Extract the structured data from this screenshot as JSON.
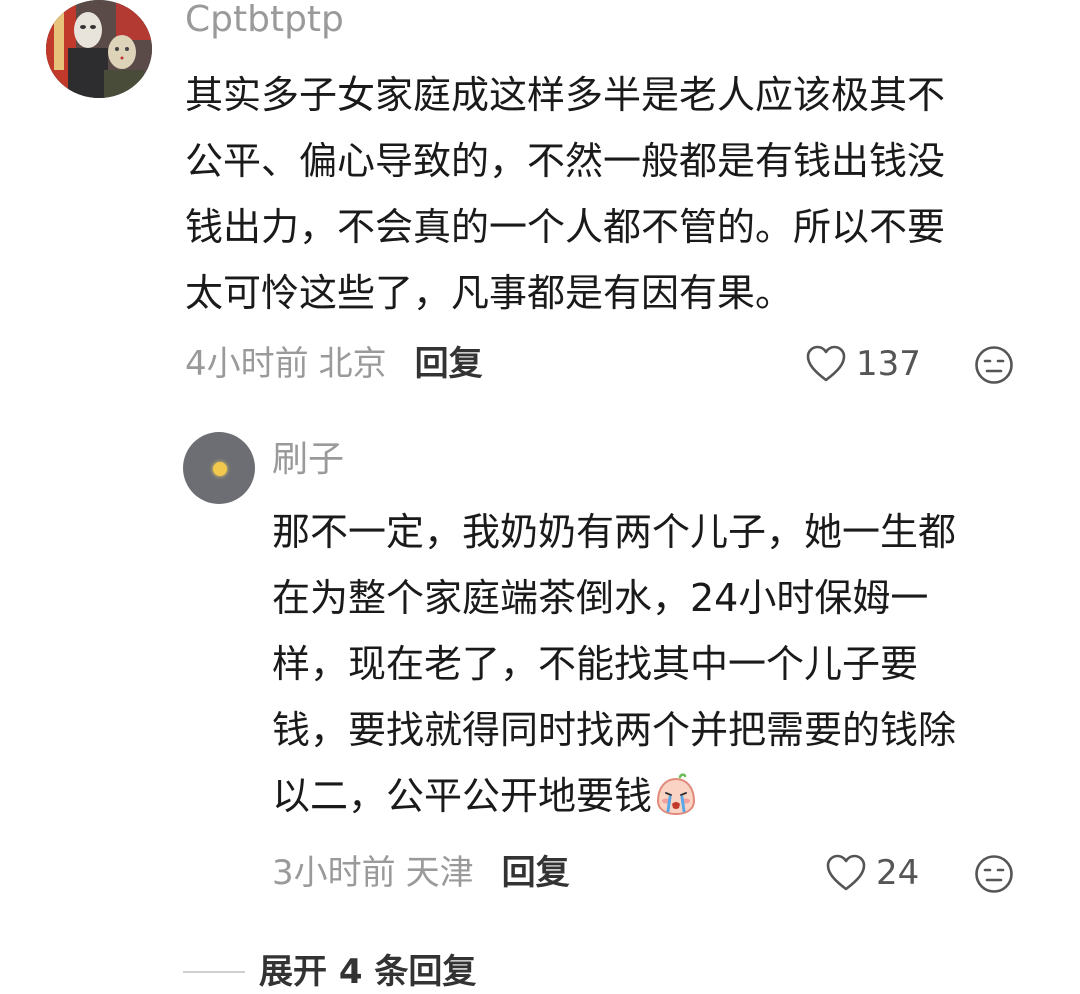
{
  "comment": {
    "username": "Cptbtptp",
    "avatar_icon": "masked-figures-avatar",
    "text_lines": [
      "其实多子女家庭成这样多半是老人应该极其不",
      "公平、偏心导致的，不然一般都是有钱出钱没",
      "钱出力，不会真的一个人都不管的。所以不要",
      "太可怜这些了，凡事都是有因有果。"
    ],
    "time": "4小时前",
    "location": "北京",
    "reply_label": "回复",
    "like_count": "137",
    "like_icon": "heart-outline-icon",
    "dislike_icon": "neutral-face-icon"
  },
  "reply": {
    "username": "刷子",
    "avatar_icon": "grey-sky-sun-avatar",
    "text_lines": [
      "那不一定，我奶奶有两个儿子，她一生都",
      "在为整个家庭端茶倒水，24小时保姆一",
      "样，现在老了，不能找其中一个儿子要",
      "钱，要找就得同时找两个并把需要的钱除",
      "以二，公平公开地要钱"
    ],
    "trailing_emoji": "crying-face-emoji",
    "time": "3小时前",
    "location": "天津",
    "reply_label": "回复",
    "like_count": "24",
    "like_icon": "heart-outline-icon",
    "dislike_icon": "neutral-face-icon"
  },
  "expand_replies": {
    "label": "展开 4 条回复"
  },
  "colors": {
    "username": "#9a9a9a",
    "body_text": "#1a1a1a",
    "meta": "#9a9a9a",
    "action": "#333333",
    "icon_stroke": "#555555"
  }
}
